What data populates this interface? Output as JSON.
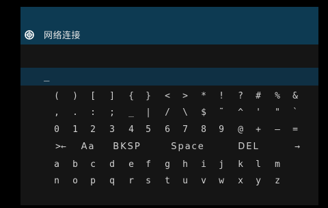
{
  "header": {
    "icon": "globe-icon",
    "title": "网络连接",
    "bg_color": "#0d3a52"
  },
  "input": {
    "value": "_"
  },
  "keyboard": {
    "rows": [
      [
        "(",
        ")",
        "[",
        "]",
        "{",
        "}",
        "<",
        ">",
        "*",
        "!",
        "?",
        "#",
        "%",
        "&"
      ],
      [
        ",",
        ".",
        ":",
        ";",
        "_",
        "|",
        "/",
        "\\",
        "$",
        "˜",
        "^",
        "'",
        "\"",
        "`"
      ],
      [
        "0",
        "1",
        "2",
        "3",
        "4",
        "5",
        "6",
        "7",
        "8",
        "9",
        "@",
        "+",
        "–",
        "="
      ],
      [
        "a",
        "b",
        "c",
        "d",
        "e",
        "f",
        "g",
        "h",
        "i",
        "j",
        "k",
        "l",
        "m"
      ],
      [
        "n",
        "o",
        "p",
        "q",
        "r",
        "s",
        "t",
        "u",
        "v",
        "w",
        "x",
        "y",
        "z"
      ]
    ],
    "function_row": {
      "left_arrow": ">←",
      "case": "Aa",
      "backspace": "BKSP",
      "space": "Space",
      "delete": "DEL",
      "right_arrow": "→"
    }
  }
}
